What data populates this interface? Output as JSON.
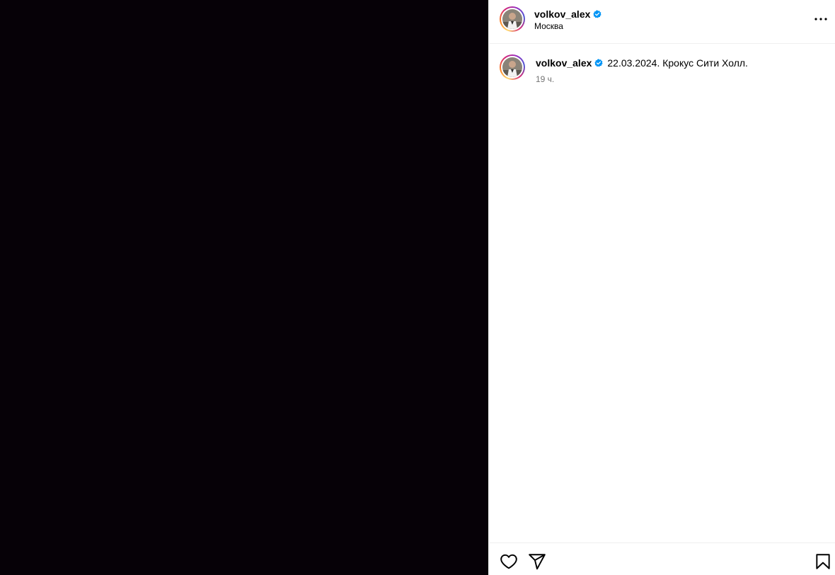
{
  "post": {
    "author": {
      "username": "volkov_alex",
      "location": "Москва",
      "verified": true
    },
    "caption": {
      "username": "volkov_alex",
      "text": "22.03.2024. Крокус Сити Холл.",
      "timestamp": "19 ч."
    },
    "media": {
      "background": "#060107"
    },
    "icons": {
      "more": "more-options-icon",
      "verified": "verified-badge-icon",
      "like": "heart-icon",
      "share": "share-icon",
      "save": "bookmark-icon"
    },
    "colors": {
      "verified": "#0095f6",
      "muted_text": "#737373",
      "divider": "#efefef"
    }
  }
}
